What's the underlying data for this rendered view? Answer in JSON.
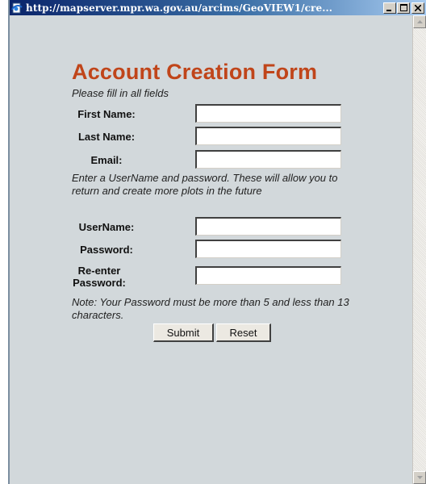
{
  "window": {
    "title": "http://mapserver.mpr.wa.gov.au/arcims/GeoVIEW1/cre...",
    "controls": {
      "minimize": "_",
      "maximize": "□",
      "close": "×"
    }
  },
  "form": {
    "title": "Account Creation Form",
    "intro": "Please fill in all fields",
    "fields_personal": [
      {
        "label": "First Name:",
        "value": ""
      },
      {
        "label": "Last Name:",
        "value": ""
      },
      {
        "label": "Email:",
        "value": ""
      }
    ],
    "account_note": "Enter a UserName and password. These will allow you to return and create more plots in the future",
    "fields_account": [
      {
        "label": "UserName:",
        "value": ""
      },
      {
        "label": "Password:",
        "value": ""
      },
      {
        "label": "Re-enter Password:",
        "value": ""
      }
    ],
    "password_note": "Note: Your Password must be more than 5 and less than 13 characters.",
    "buttons": {
      "submit": "Submit",
      "reset": "Reset"
    }
  },
  "icons": {
    "page": "ie-page-icon",
    "minimize": "minimize-icon",
    "maximize": "maximize-icon",
    "close": "close-icon",
    "scroll_up": "scroll-up-arrow-icon",
    "scroll_down": "scroll-down-arrow-icon"
  }
}
